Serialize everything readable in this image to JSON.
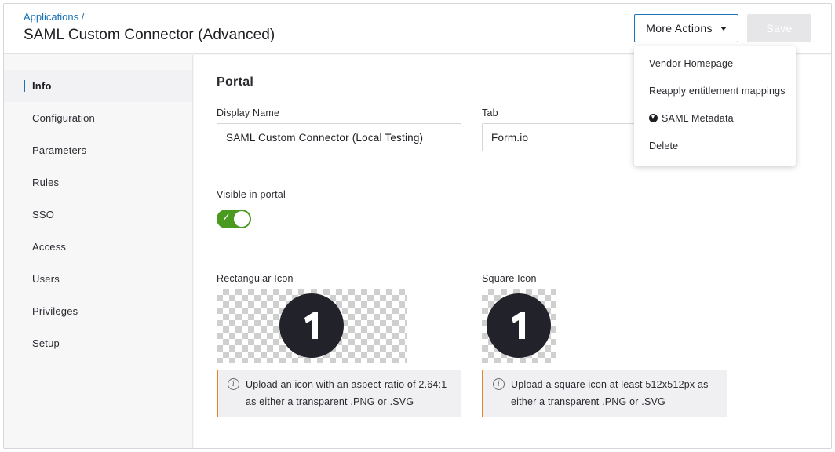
{
  "header": {
    "breadcrumb": "Applications /",
    "title": "SAML Custom Connector (Advanced)",
    "more_actions_label": "More Actions",
    "save_label": "Save"
  },
  "sidebar": {
    "items": [
      {
        "label": "Info",
        "active": true
      },
      {
        "label": "Configuration",
        "active": false
      },
      {
        "label": "Parameters",
        "active": false
      },
      {
        "label": "Rules",
        "active": false
      },
      {
        "label": "SSO",
        "active": false
      },
      {
        "label": "Access",
        "active": false
      },
      {
        "label": "Users",
        "active": false
      },
      {
        "label": "Privileges",
        "active": false
      },
      {
        "label": "Setup",
        "active": false
      }
    ]
  },
  "portal": {
    "section_title": "Portal",
    "display_name_label": "Display Name",
    "display_name_value": "SAML Custom Connector (Local Testing)",
    "tab_label": "Tab",
    "tab_value": "Form.io",
    "visible_label": "Visible in portal",
    "visible_on": true,
    "rect_icon_label": "Rectangular Icon",
    "square_icon_label": "Square Icon",
    "icon_glyph": "1",
    "rect_help": "Upload an icon with an aspect-ratio of 2.64:1 as either a transparent .PNG or .SVG",
    "square_help": "Upload a square icon at least 512x512px as either a transparent .PNG or .SVG"
  },
  "dropdown": {
    "items": [
      {
        "label": "Vendor Homepage",
        "icon": null
      },
      {
        "label": "Reapply entitlement mappings",
        "icon": null
      },
      {
        "label": "SAML Metadata",
        "icon": "download-circle-icon"
      },
      {
        "label": "Delete",
        "icon": null
      }
    ]
  },
  "colors": {
    "accent": "#1a73b5",
    "toggle_on": "#4a9a1f",
    "warning_border": "#e8822b"
  }
}
